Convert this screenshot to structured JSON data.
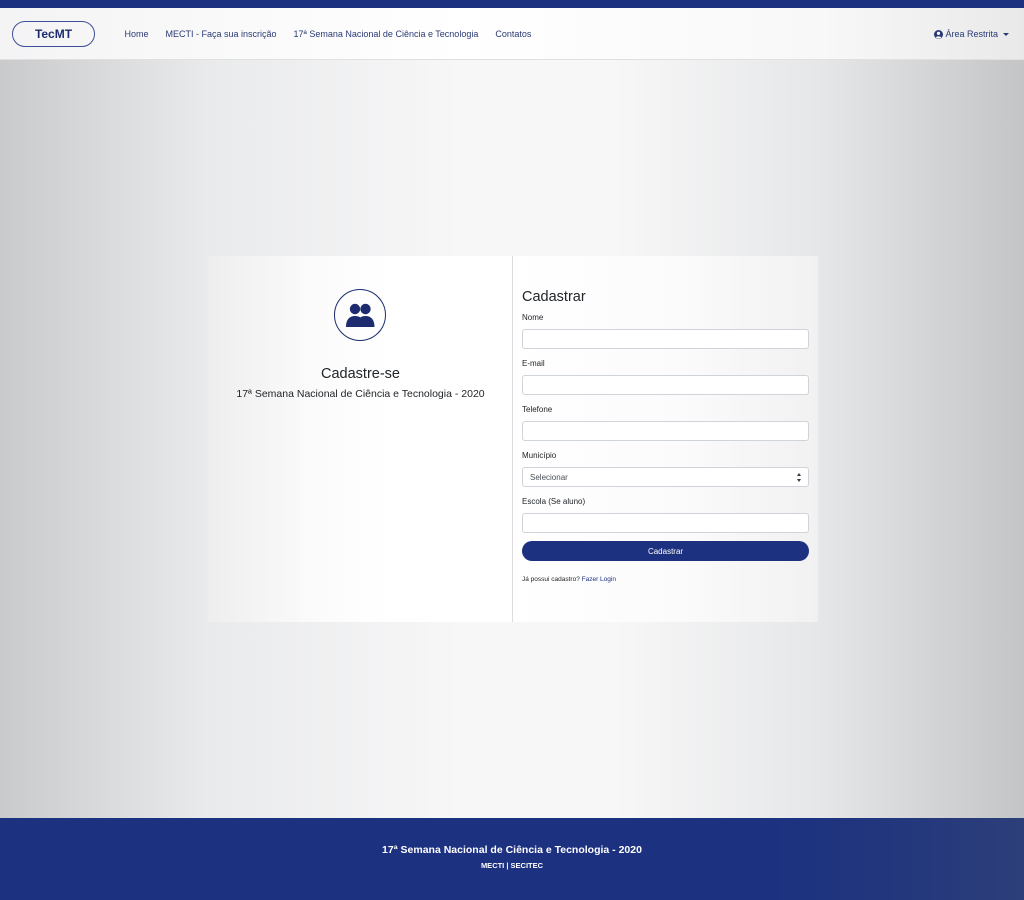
{
  "navbar": {
    "brand": "TecMT",
    "links": [
      "Home",
      "MECTI - Faça sua inscrição",
      "17ª Semana Nacional de Ciência e Tecnologia",
      "Contatos"
    ],
    "restricted_area": "Área Restrita",
    "user_icon": "user-circle-icon"
  },
  "left_panel": {
    "icon": "users-icon",
    "title": "Cadastre-se",
    "subtitle": "17ª Semana Nacional de Ciência e Tecnologia - 2020"
  },
  "form": {
    "title": "Cadastrar",
    "name_label": "Nome",
    "name_value": "",
    "email_label": "E-mail",
    "email_value": "",
    "phone_label": "Telefone",
    "phone_value": "",
    "city_label": "Município",
    "city_selected": "Selecionar",
    "school_label": "Escola (Se aluno)",
    "school_value": "",
    "submit_label": "Cadastrar",
    "login_prompt": "Já possui cadastro?",
    "login_link": "Fazer Login"
  },
  "footer": {
    "title": "17ª Semana Nacional de Ciência e Tecnologia - 2020",
    "subtitle": "MECTI | SECITEC"
  },
  "colors": {
    "primary": "#1c3180",
    "nav_text": "#2b3a75"
  }
}
